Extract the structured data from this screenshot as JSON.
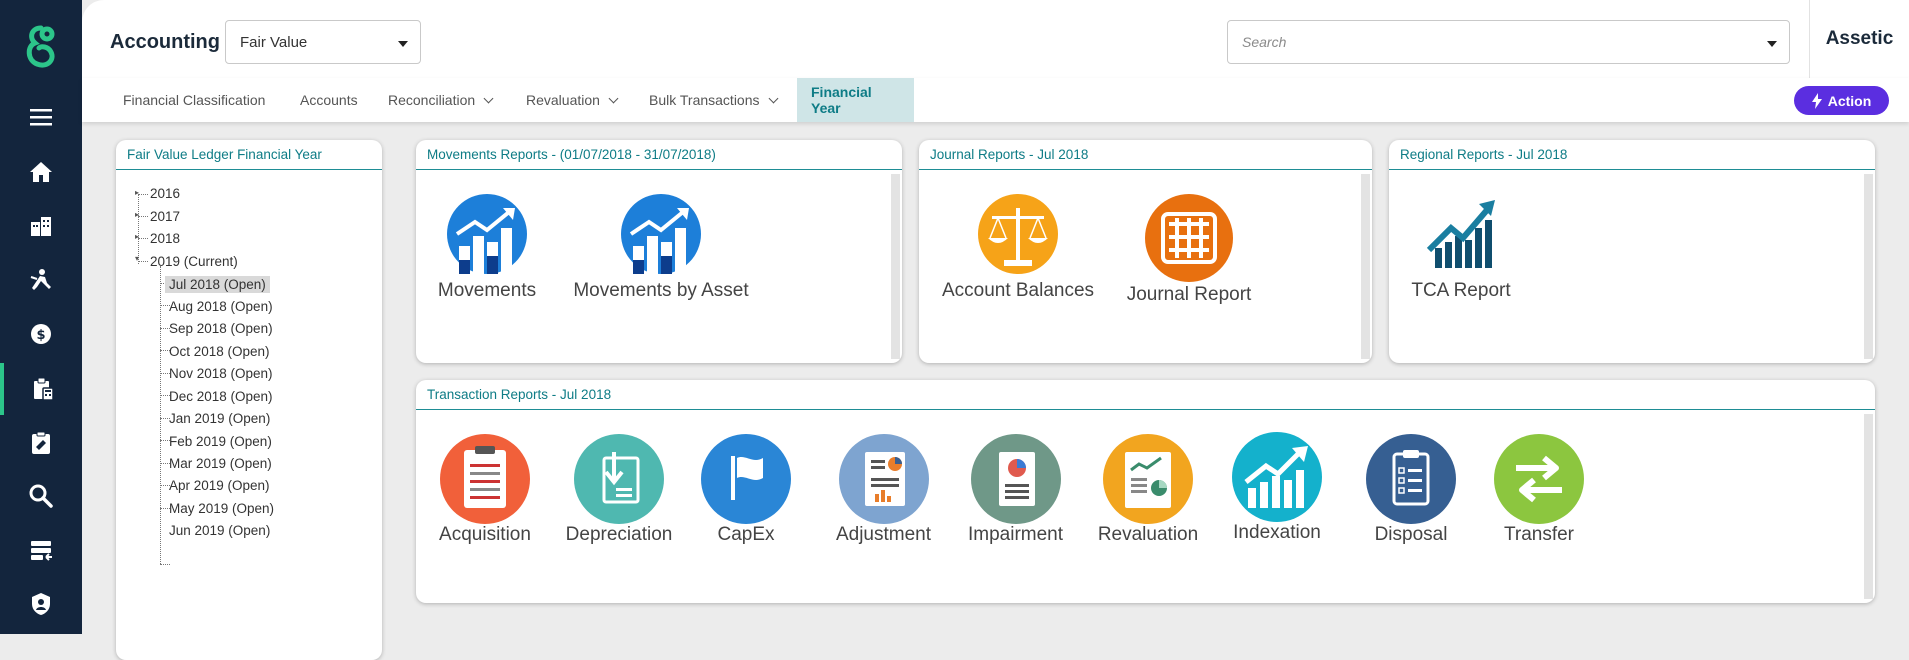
{
  "header": {
    "app_title": "Accounting",
    "context_select": "Fair Value",
    "search_placeholder": "Search",
    "brand": "Assetic"
  },
  "tabs": [
    {
      "label": "Financial Classification",
      "has_menu": false,
      "active": false
    },
    {
      "label": "Accounts",
      "has_menu": false,
      "active": false
    },
    {
      "label": "Reconciliation",
      "has_menu": true,
      "active": false
    },
    {
      "label": "Revaluation",
      "has_menu": true,
      "active": false
    },
    {
      "label": "Bulk Transactions",
      "has_menu": true,
      "active": false
    },
    {
      "label": "Financial Year",
      "has_menu": false,
      "active": true
    }
  ],
  "action_button": "Action",
  "sidebar": {
    "icons": [
      "menu-icon",
      "home-icon",
      "buildings-icon",
      "worker-icon",
      "finance-icon",
      "accounting-icon",
      "work-order-icon",
      "search-icon",
      "data-exchange-icon",
      "shield-icon"
    ],
    "active": "accounting-icon"
  },
  "ledger_panel": {
    "title": "Fair Value Ledger Financial Year",
    "years": [
      "2016",
      "2017",
      "2018",
      "2019 (Current)"
    ],
    "periods": [
      "Jul 2018 (Open)",
      "Aug 2018 (Open)",
      "Sep 2018 (Open)",
      "Oct 2018 (Open)",
      "Nov 2018 (Open)",
      "Dec 2018 (Open)",
      "Jan 2019 (Open)",
      "Feb 2019 (Open)",
      "Mar 2019 (Open)",
      "Apr 2019 (Open)",
      "May 2019 (Open)",
      "Jun 2019 (Open)"
    ],
    "selected_period": "Jul 2018 (Open)"
  },
  "movements_panel": {
    "title": "Movements Reports - (01/07/2018 - 31/07/2018)",
    "tiles": [
      "Movements",
      "Movements by Asset"
    ]
  },
  "journal_panel": {
    "title": "Journal Reports - Jul 2018",
    "tiles": [
      "Account Balances",
      "Journal Report"
    ]
  },
  "regional_panel": {
    "title": "Regional Reports - Jul 2018",
    "tiles": [
      "TCA Report"
    ]
  },
  "transaction_panel": {
    "title": "Transaction Reports - Jul 2018",
    "tiles": [
      "Acquisition",
      "Depreciation",
      "CapEx",
      "Adjustment",
      "Impairment",
      "Revaluation",
      "Indexation",
      "Disposal",
      "Transfer"
    ]
  },
  "colors": {
    "sidebar": "#13253d",
    "accent_teal": "#0e7c86",
    "action_purple": "#5b2ee0",
    "acquisition": "#f1603a",
    "depreciation": "#4fb8b0",
    "capex": "#2a86d6",
    "adjustment": "#7ea4d0",
    "impairment": "#6f9888",
    "revaluation": "#f2a51f",
    "indexation": "#14b1cc",
    "disposal": "#365f92",
    "transfer": "#8cc63f"
  }
}
